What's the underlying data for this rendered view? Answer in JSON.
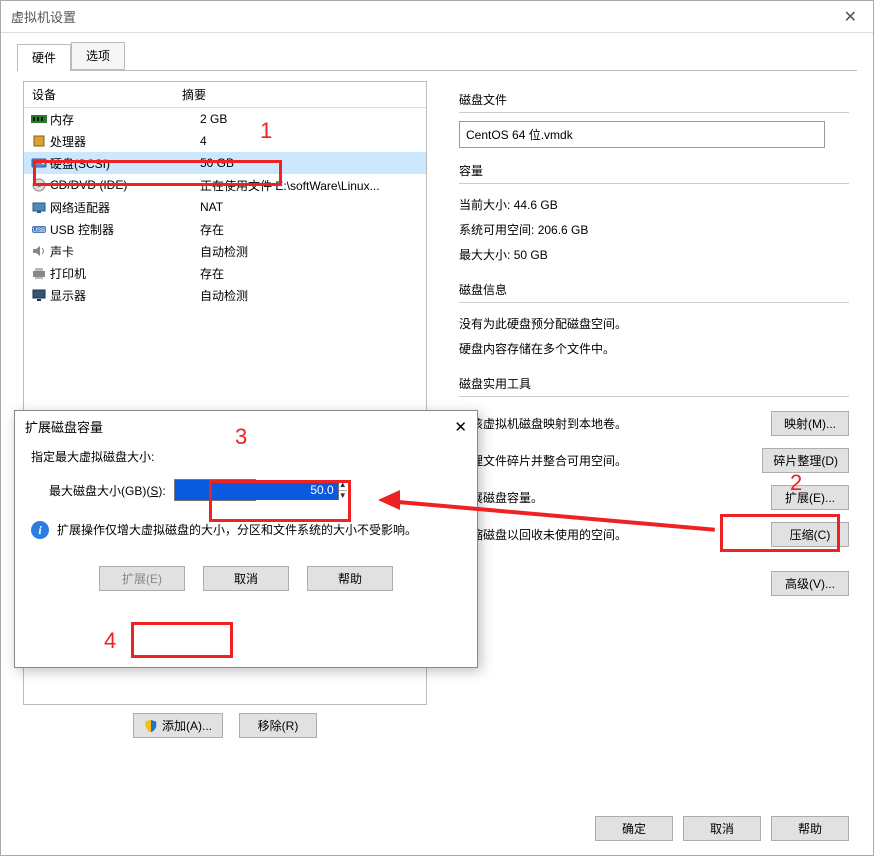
{
  "window": {
    "title": "虚拟机设置"
  },
  "tabs": {
    "hardware": "硬件",
    "options": "选项"
  },
  "device_table": {
    "col_device": "设备",
    "col_summary": "摘要",
    "rows": [
      {
        "name": "内存",
        "summary": "2 GB",
        "icon": "memory"
      },
      {
        "name": "处理器",
        "summary": "4",
        "icon": "cpu"
      },
      {
        "name": "硬盘(SCSI)",
        "summary": "50 GB",
        "icon": "disk",
        "selected": true
      },
      {
        "name": "CD/DVD (IDE)",
        "summary": "正在使用文件 E:\\softWare\\Linux...",
        "icon": "cd"
      },
      {
        "name": "网络适配器",
        "summary": "NAT",
        "icon": "net"
      },
      {
        "name": "USB 控制器",
        "summary": "存在",
        "icon": "usb"
      },
      {
        "name": "声卡",
        "summary": "自动检测",
        "icon": "sound"
      },
      {
        "name": "打印机",
        "summary": "存在",
        "icon": "printer"
      },
      {
        "name": "显示器",
        "summary": "自动检测",
        "icon": "display"
      }
    ]
  },
  "disk_file": {
    "header": "磁盘文件",
    "value": "CentOS 64 位.vmdk"
  },
  "capacity": {
    "header": "容量",
    "current_label": "当前大小:",
    "current_value": "44.6 GB",
    "free_label": "系统可用空间:",
    "free_value": "206.6 GB",
    "max_label": "最大大小:",
    "max_value": "50 GB"
  },
  "disk_info": {
    "header": "磁盘信息",
    "line1": "没有为此硬盘预分配磁盘空间。",
    "line2": "硬盘内容存储在多个文件中。"
  },
  "tools": {
    "header": "磁盘实用工具",
    "map_desc": "将该虚拟机磁盘映射到本地卷。",
    "map_btn": "映射(M)...",
    "defrag_desc": "整理文件碎片并整合可用空间。",
    "defrag_btn": "碎片整理(D)",
    "expand_desc": "扩展磁盘容量。",
    "expand_btn": "扩展(E)...",
    "compact_desc": "压缩磁盘以回收未使用的空间。",
    "compact_btn": "压缩(C)",
    "advanced_btn": "高级(V)..."
  },
  "bottom": {
    "add_btn": "添加(A)...",
    "remove_btn": "移除(R)",
    "ok": "确定",
    "cancel": "取消",
    "help": "帮助"
  },
  "popup": {
    "title": "扩展磁盘容量",
    "subtitle": "指定最大虚拟磁盘大小:",
    "field_label_pre": "最大磁盘大小(GB)(",
    "field_label_key": "S",
    "field_label_post": "):",
    "field_value": "50.0",
    "info_text": "扩展操作仅增大虚拟磁盘的大小，分区和文件系统的大小不受影响。",
    "expand_btn": "扩展(E)",
    "cancel_btn": "取消",
    "help_btn": "帮助"
  },
  "annotations": {
    "n1": "1",
    "n2": "2",
    "n3": "3",
    "n4": "4"
  }
}
